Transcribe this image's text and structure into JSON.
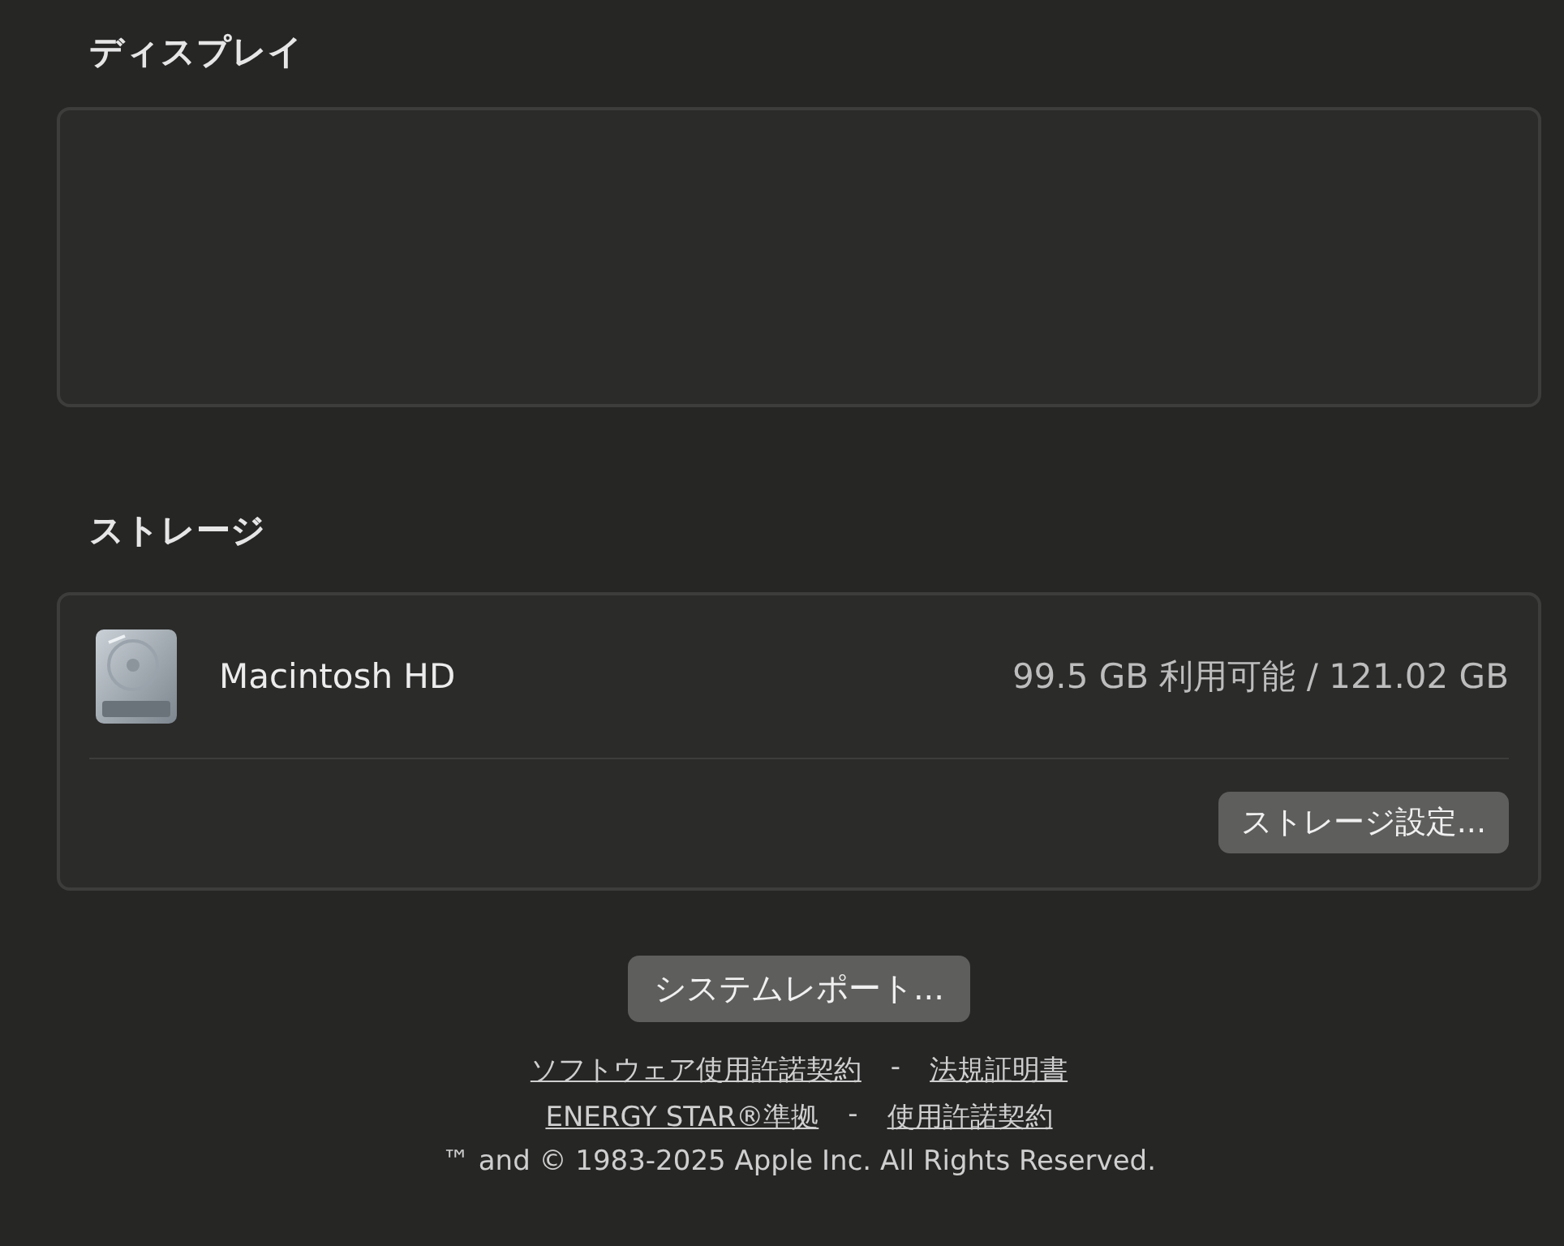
{
  "display_section": {
    "heading": "ディスプレイ"
  },
  "storage_section": {
    "heading": "ストレージ",
    "disk": {
      "name": "Macintosh HD",
      "capacity": "99.5 GB 利用可能 / 121.02 GB"
    },
    "settings_button": "ストレージ設定..."
  },
  "system_report_button": "システムレポート...",
  "footer": {
    "link_rows": [
      {
        "links": [
          "ソフトウェア使用許諾契約",
          "法規証明書"
        ],
        "separator": "-"
      },
      {
        "links": [
          "ENERGY STAR®準拠",
          "使用許諾契約"
        ],
        "separator": "-"
      }
    ],
    "copyright": "™ and © 1983-2025 Apple Inc. All Rights Reserved."
  }
}
